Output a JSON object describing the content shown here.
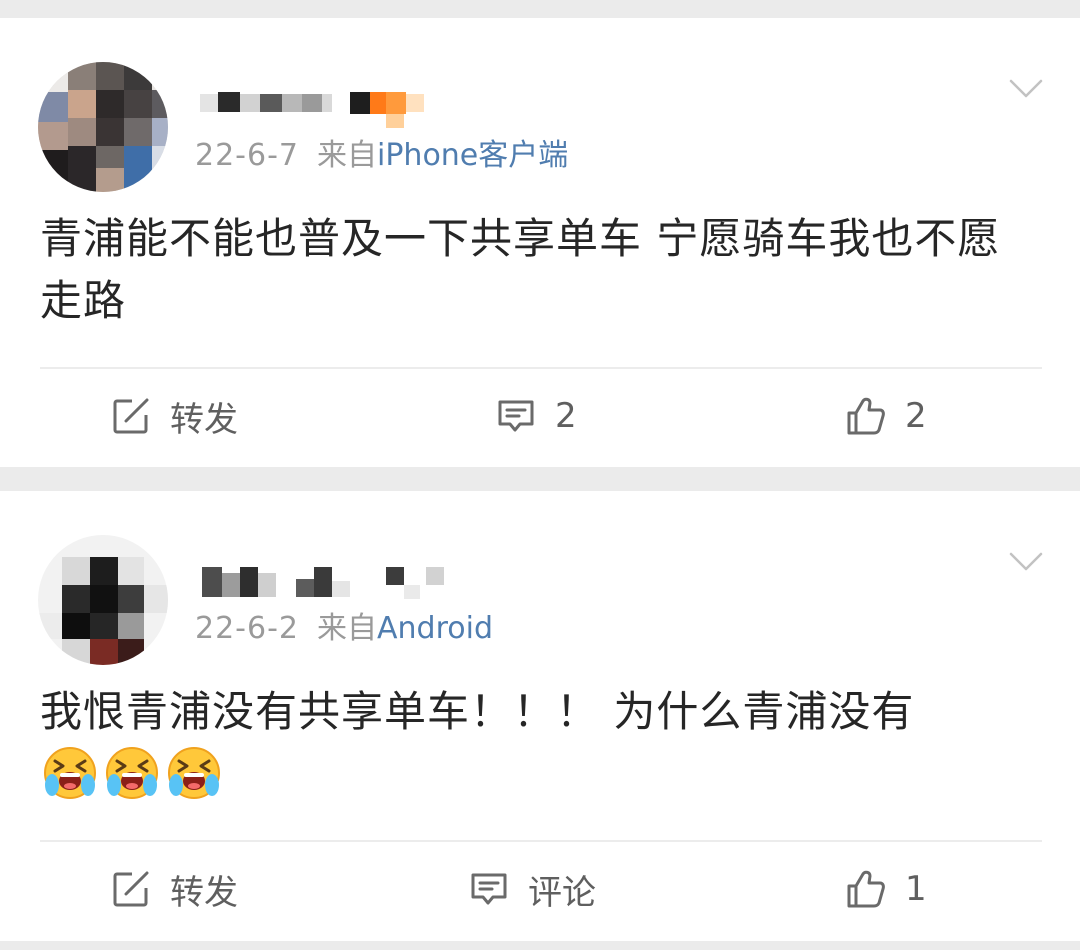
{
  "posts": [
    {
      "date": "22-6-7",
      "from_label": "来自",
      "source": "iPhone客户端",
      "content": "青浦能不能也普及一下共享单车 宁愿骑车我也不愿走路",
      "emojis": [],
      "repost_label": "转发",
      "comment_label": "2",
      "like_label": "2"
    },
    {
      "date": "22-6-2",
      "from_label": "来自",
      "source": "Android",
      "content": "我恨青浦没有共享单车！！！ 为什么青浦没有",
      "emojis": [
        "crying-face",
        "crying-face",
        "crying-face"
      ],
      "repost_label": "转发",
      "comment_label": "评论",
      "like_label": "1"
    }
  ],
  "colors": {
    "background": "#ebebeb",
    "card": "#ffffff",
    "text": "#262626",
    "meta": "#9a9a9a",
    "source_link": "#507daf",
    "action": "#5f5f5f"
  }
}
